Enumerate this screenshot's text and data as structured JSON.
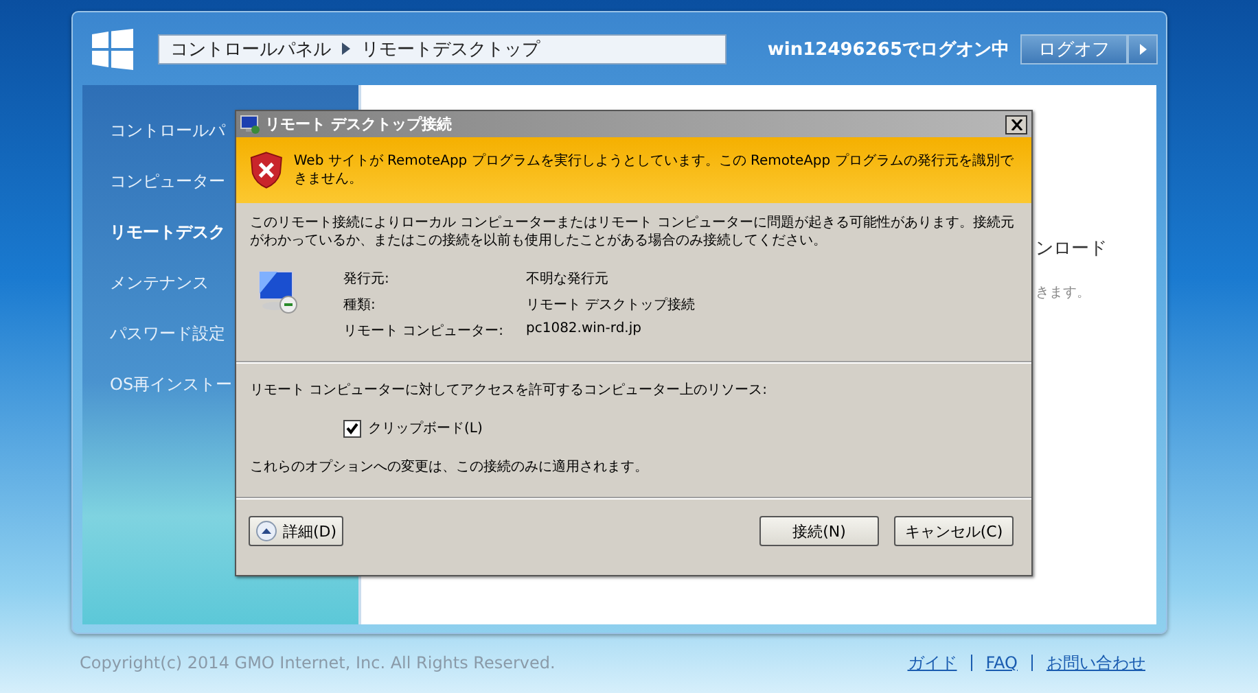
{
  "header": {
    "breadcrumb": [
      "コントロールパネル",
      "リモートデスクトップ"
    ],
    "user_status": "win12496265でログオン中",
    "logoff_button": "ログオフ"
  },
  "sidebar": {
    "items": [
      {
        "label": "コントロールパ",
        "selected": false
      },
      {
        "label": "コンピューター",
        "selected": false
      },
      {
        "label": "リモートデスク",
        "selected": true
      },
      {
        "label": "メンテナンス",
        "selected": false
      },
      {
        "label": "パスワード設定",
        "selected": false
      },
      {
        "label": "OS再インストー",
        "selected": false
      }
    ]
  },
  "content": {
    "heading": "ンロード",
    "text": "きます。"
  },
  "dialog": {
    "title": "リモート デスクトップ接続",
    "warning": "Web サイトが RemoteApp プログラムを実行しようとしています。この RemoteApp プログラムの発行元を識別できません。",
    "description": "このリモート接続によりローカル コンピューターまたはリモート コンピューターに問題が起きる可能性があります。接続元がわかっているか、またはこの接続を以前も使用したことがある場合のみ接続してください。",
    "details": [
      {
        "label": "発行元:",
        "value": "不明な発行元"
      },
      {
        "label": "種類:",
        "value": "リモート デスクトップ接続"
      },
      {
        "label": "リモート コンピューター:",
        "value": "pc1082.win-rd.jp"
      }
    ],
    "resources_label": "リモート コンピューターに対してアクセスを許可するコンピューター上のリソース:",
    "options": [
      {
        "label": "クリップボード(L)",
        "checked": true
      }
    ],
    "note": "これらのオプションへの変更は、この接続のみに適用されます。",
    "details_button": "詳細(D)",
    "buttons": [
      "接続(N)",
      "キャンセル(C)"
    ]
  },
  "footer": {
    "copyright": "Copyright(c) 2014 GMO Internet, Inc. All Rights Reserved.",
    "links": [
      "ガイド",
      "FAQ",
      "お問い合わせ"
    ]
  }
}
